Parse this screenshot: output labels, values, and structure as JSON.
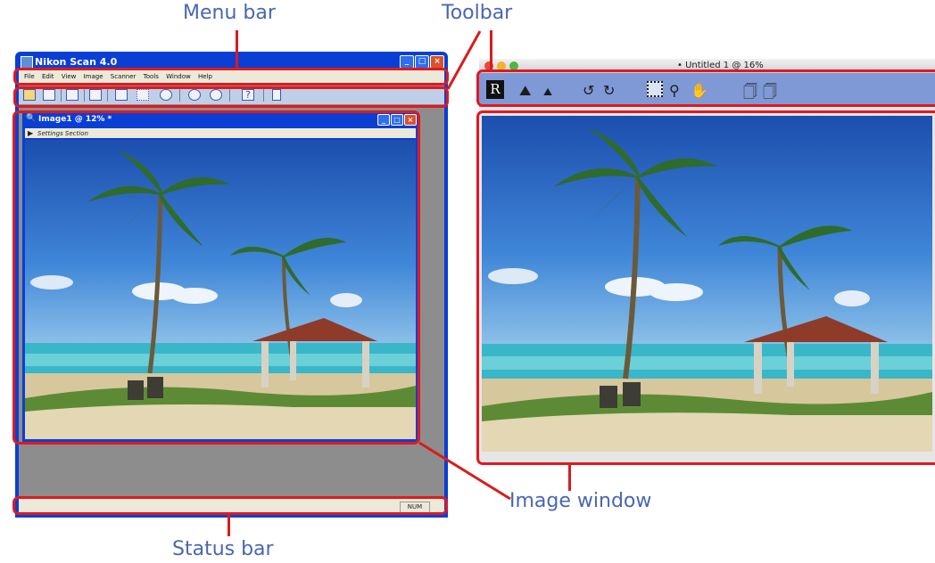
{
  "callouts": {
    "menu_bar": "Menu bar",
    "toolbar": "Toolbar",
    "image_window": "Image window",
    "status_bar": "Status bar"
  },
  "windows_app": {
    "title": "Nikon Scan 4.0",
    "menu": [
      "File",
      "Edit",
      "View",
      "Image",
      "Scanner",
      "Tools",
      "Window",
      "Help"
    ],
    "image_window_title": "Image1 @ 12% *",
    "settings_label": "Settings Section",
    "status_indicator": "NUM",
    "toolbar_icons": [
      "open-icon",
      "save-icon",
      "copy-icon",
      "print-icon",
      "hand-icon",
      "crop-icon",
      "zoom-icon",
      "rotate-left-icon",
      "rotate-right-icon",
      "help-icon",
      "info-icon"
    ]
  },
  "mac_app": {
    "title": "• Untitled 1 @ 16%",
    "toolbar_icons": [
      "r-icon",
      "mountain-large-icon",
      "mountain-small-icon",
      "rotate-left-icon",
      "rotate-right-icon",
      "crop-icon",
      "zoom-icon",
      "hand-icon",
      "copy-icon",
      "duplicate-icon"
    ]
  },
  "colors": {
    "accent_callout": "#4a66b2",
    "highlight": "#e0191f",
    "xp_blue": "#0a3fd6",
    "mac_toolbar": "#7f99d6"
  }
}
